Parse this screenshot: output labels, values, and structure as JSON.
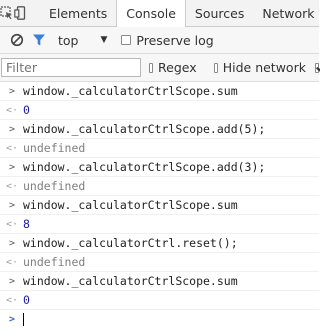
{
  "tabs": {
    "elements": "Elements",
    "console": "Console",
    "sources": "Sources",
    "network": "Network"
  },
  "toolbar": {
    "context": "top",
    "preserve_log": "Preserve log"
  },
  "filterbar": {
    "placeholder": "Filter",
    "regex": "Regex",
    "hide_network": "Hide network"
  },
  "console": {
    "lines": [
      {
        "kind": "input",
        "text": "window._calculatorCtrlScope.sum"
      },
      {
        "kind": "number",
        "text": "0"
      },
      {
        "kind": "input",
        "text": "window._calculatorCtrlScope.add(5);"
      },
      {
        "kind": "undefined",
        "text": "undefined"
      },
      {
        "kind": "input",
        "text": "window._calculatorCtrlScope.add(3);"
      },
      {
        "kind": "undefined",
        "text": "undefined"
      },
      {
        "kind": "input",
        "text": "window._calculatorCtrlScope.sum"
      },
      {
        "kind": "number",
        "text": "8"
      },
      {
        "kind": "input",
        "text": "window._calculatorCtrl.reset();"
      },
      {
        "kind": "undefined",
        "text": "undefined"
      },
      {
        "kind": "input",
        "text": "window._calculatorCtrlScope.sum"
      },
      {
        "kind": "number",
        "text": "0"
      }
    ]
  }
}
